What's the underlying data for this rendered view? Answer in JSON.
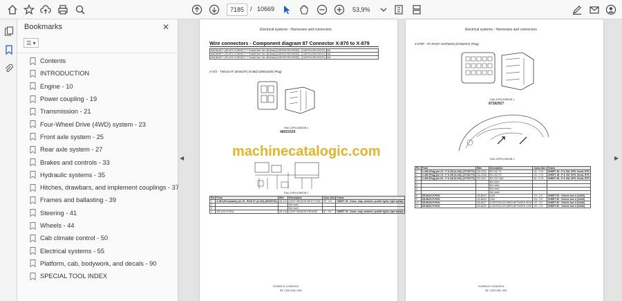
{
  "toolbar": {
    "current_page": "7185",
    "separator": "/",
    "total_pages": "10669",
    "zoom": "53,9%"
  },
  "bookmarks": {
    "title": "Bookmarks",
    "options_label": "☰ ▾",
    "items": [
      "Contents",
      "INTRODUCTION",
      "Engine - 10",
      "Power coupling - 19",
      "Transmission - 21",
      "Four-Wheel Drive (4WD) system - 23",
      "Front axle system - 25",
      "Rear axle system - 27",
      "Brakes and controls - 33",
      "Hydraulic systems - 35",
      "Hitches, drawbars, and implement couplings - 37",
      "Frames and ballasting - 39",
      "Steering - 41",
      "Wheels - 44",
      "Cab climate control - 50",
      "Electrical systems - 55",
      "Platform, cab, bodywork, and decals - 90",
      "SPECIAL TOOL INDEX"
    ]
  },
  "page1": {
    "header": "Electrical systems - Harnesses and connectors",
    "title": "Wire connectors - Component diagram 87 Connector X-870 to X-879",
    "model_rows": [
      [
        "MAGNUM™ 180 AFS CONNECT™ PowerDrive Tier 4B (final) [ZJAF0007RLR00052] - [ZJAF00111RLR0XXX]",
        "NA"
      ],
      [
        "MAGNUM™ 200 AFS CONNECT™ PowerDrive Tier 4B (final) [ZJAF0007RLR00052] - [ZJAF00111RLR0XXX]",
        "NA"
      ],
      [
        "MAGNUM™ 220 AFS CONNECT™ PowerDrive Tier 4B (final) [ZJAF0007RLR00052] - [ZJAF00111RLR0XXX]",
        "NA"
      ]
    ],
    "section": "X-872 - TWILIGHT SENSOR [ B-080] (48053339) (Plug)",
    "part_number": "48053339",
    "part_ref": "RAIL19PI018BS0B 1",
    "diagram_ref": "RAIL19PI019BS0B 2",
    "table_headers": [
      "Pin",
      "From",
      "Wire",
      "Description",
      "Color-Size",
      "Frame"
    ],
    "table_rows": [
      [
        "1",
        "X-464 (Receptacle) pin 15 - BCM X7 (A-010) (84525762)",
        "CB-113",
        "LIGHT SENSOR INPUT FUNC",
        "YE - 0.5",
        "SHEET 28 - Dome, map, ambient, puddle lights, light sensor"
      ],
      [
        "2",
        "",
        "",
        "Not used",
        "",
        ""
      ],
      [
        "3",
        "",
        "",
        "Not used",
        "",
        ""
      ],
      [
        "4",
        "DR-1102-P-PIN1",
        "CB-113",
        "LIGHT SENSOR GROUND",
        "BL - 0.5",
        "SHEET 28 - Dome, map, ambient, puddle lights, light sensor"
      ]
    ],
    "footer_code": "S2350013 12/06/2024",
    "footer_page": "55.7 [55.100] / 840"
  },
  "page2": {
    "header": "Electrical systems - Harnesses and connectors",
    "section": "X-875P - TO ROOF HARNESS (87382927) (Plug)",
    "part_number": "87382927",
    "part_ref": "RAIL19PI020BS0B 1",
    "diagram_ref": "RAIL19PI021BS0B 2",
    "table_headers": [
      "Pin",
      "From",
      "Wire",
      "Description",
      "Color-Size",
      "Frame"
    ],
    "table_rows": [
      [
        "1",
        "X-406 (Plug) pin C2 - P & CM (A-031) (47730770)",
        "CB-232A",
        "RS-232 TX",
        "LB - 0.75",
        "SHEET 48 - P & CM, GPS, Serial, RTK"
      ],
      [
        "2",
        "X-406 (Plug) pin C3 - P & CM (A-031) (47730770)",
        "CB-232B",
        "RS-232 RX",
        "LB - 0.75",
        "SHEET 48 - P & CM, GPS, Serial, RTK"
      ],
      [
        "3",
        "X-406 (Plug) pin K4 - P & CM (A-031) (47730770)",
        "CB-232C",
        "RS-232 GND",
        "BL - 0.75",
        "SHEET 48 - P & CM, GPS, Serial, RTK"
      ],
      [
        "4",
        "",
        "",
        "Not used",
        "",
        ""
      ],
      [
        "5",
        "",
        "",
        "Not used",
        "",
        ""
      ],
      [
        "6",
        "",
        "",
        "Not used",
        "",
        ""
      ],
      [
        "7",
        "",
        "",
        "Not used",
        "",
        ""
      ],
      [
        "8",
        "DR-861H-P-PIN1",
        "CB-861H",
        "CAN",
        "YE - 0.5",
        "SHEET 60 - Vehicle bus 3 (CAN3)"
      ],
      [
        "9",
        "DR-862H-P-PIN1",
        "CB-862H",
        "CAN",
        "GN - 0.5",
        "SHEET 60 - Vehicle bus 3 (CAN3)"
      ],
      [
        "10",
        "DR-861B-P-PIN1",
        "CB-861T",
        "CONTROLLER AREA NETWORK HIGH",
        "YE - 0.5",
        "SHEET 60 - Vehicle bus 3 (CAN3)"
      ],
      [
        "11",
        "DR-862D-P-PIN1",
        "CB-862D",
        "CONTROLLER AREA NETWORK LOW",
        "GN - 0.5",
        "SHEET 60 - Vehicle bus 3 (CAN3)"
      ]
    ],
    "footer_code": "S2350013 12/06/2024",
    "footer_page": "55.7 [55.100] / 841"
  },
  "watermark": "machinecatalogic.com",
  "colors": {
    "accent": "#1a62c9",
    "watermark": "#e6a500"
  }
}
